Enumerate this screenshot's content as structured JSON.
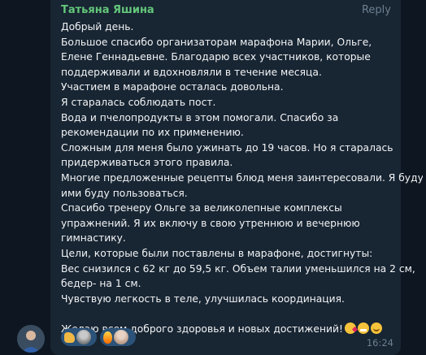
{
  "message": {
    "sender": "Татьяна Яшина",
    "reply_label": "Reply",
    "lines": [
      "Добрый день.",
      "Большое спасибо организаторам марафона Марии, Ольге,",
      "Елене Геннадьевне. Благодарю всех участников, которые",
      "поддерживали и вдохновляли в течение месяца.",
      "Участием в марафоне осталась довольна.",
      "Я старалась соблюдать пост.",
      "Вода и пчелопродукты в этом помогали. Спасибо за",
      "рекомендации по их применению.",
      "Сложным для меня было ужинать до 19 часов. Но я старалась",
      "придерживаться этого правила.",
      "Многие предложенные рецепты блюд меня заинтересовали. Я буду",
      "ими буду пользоваться.",
      "Спасибо тренеру Ольге за великолепные комплексы",
      "упражнений. Я их включу в свою утреннюю и вечернюю",
      "гимнастику.",
      "Цели, которые были поставлены в марафоне, достигнуты:",
      "Вес снизился с 62 кг до 59,5 кг. Объем талии уменьшился на 2 см,",
      "бедер- на 1 см.",
      "Чувствую легкость в теле, улучшилась координация.",
      "",
      "Желаю всем доброго здоровья и новых достижений!"
    ],
    "closing_emojis": [
      "face-blowing-kiss",
      "grinning-face",
      "smiling-face"
    ],
    "time": "16:24",
    "reactions": [
      {
        "emoji": "thumbs-up",
        "avatar": "user-avatar"
      },
      {
        "emoji": "fire",
        "avatar": "user-avatar"
      }
    ]
  },
  "colors": {
    "background": "#0e1621",
    "bubble": "#182533",
    "sender": "#63c77a",
    "text": "#f2f4f5",
    "meta": "#6d7f8f",
    "reaction": "#2b5278"
  }
}
